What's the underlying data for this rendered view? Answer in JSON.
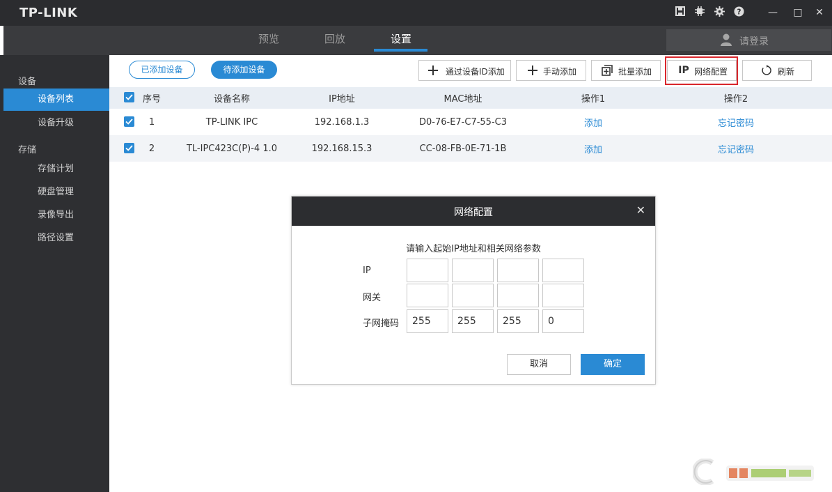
{
  "app": {
    "logo": "TP-LINK",
    "window_controls": {
      "minimize": "—",
      "maximize": "□",
      "close": "✕"
    }
  },
  "nav": {
    "tabs": [
      {
        "label": "预览"
      },
      {
        "label": "回放"
      },
      {
        "label": "设置"
      }
    ],
    "active": "设置",
    "login_label": "请登录"
  },
  "sidebar": {
    "groups": [
      {
        "label": "设备",
        "items": [
          "设备列表",
          "设备升级"
        ]
      },
      {
        "label": "存储",
        "items": [
          "存储计划",
          "硬盘管理",
          "录像导出",
          "路径设置"
        ]
      }
    ],
    "active_item": "设备列表"
  },
  "toolbar": {
    "tab_added": "已添加设备",
    "tab_pending": "待添加设备",
    "buttons": [
      {
        "label": "通过设备ID添加",
        "icon": "plus-icon"
      },
      {
        "label": "手动添加",
        "icon": "plus-icon"
      },
      {
        "label": "批量添加",
        "icon": "batch-add-icon"
      },
      {
        "label": "网络配置",
        "icon_text": "IP"
      },
      {
        "label": "刷新",
        "icon": "refresh-icon"
      }
    ],
    "highlighted_button": "网络配置"
  },
  "table": {
    "columns": [
      "序号",
      "设备名称",
      "IP地址",
      "MAC地址",
      "操作1",
      "操作2"
    ],
    "rows": [
      {
        "index": "1",
        "name": "TP-LINK IPC",
        "ip": "192.168.1.3",
        "mac": "D0-76-E7-C7-55-C3",
        "op1": "添加",
        "op2": "忘记密码",
        "checked": true
      },
      {
        "index": "2",
        "name": "TL-IPC423C(P)-4 1.0",
        "ip": "192.168.15.3",
        "mac": "CC-08-FB-0E-71-1B",
        "op1": "添加",
        "op2": "忘记密码",
        "checked": true
      }
    ]
  },
  "modal": {
    "title": "网络配置",
    "close": "✕",
    "description": "请输入起始IP地址和相关网络参数",
    "fields": [
      {
        "label": "IP",
        "values": [
          "",
          "",
          "",
          ""
        ]
      },
      {
        "label": "网关",
        "values": [
          "",
          "",
          "",
          ""
        ]
      },
      {
        "label": "子网掩码",
        "values": [
          "255",
          "255",
          "255",
          "0"
        ]
      }
    ],
    "cancel_label": "取消",
    "ok_label": "确定"
  },
  "colors": {
    "accent": "#2a8ad4",
    "titlebar": "#2b2c2f",
    "sidebar": "#2e2f32",
    "highlight_frame": "#d9262c"
  }
}
